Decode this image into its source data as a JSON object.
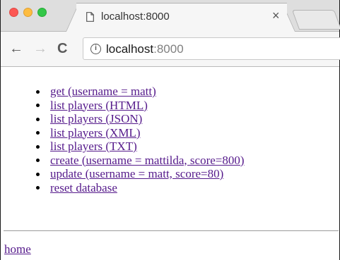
{
  "browser": {
    "tab": {
      "title": "localhost:8000",
      "close_glyph": "×",
      "icon": "page-icon"
    },
    "toolbar": {
      "back_glyph": "←",
      "forward_glyph": "→",
      "reload_glyph": "C",
      "info_glyph": "i",
      "url_host": "localhost",
      "url_port": ":8000"
    },
    "traffic_colors": {
      "close": "#fc5753",
      "minimize": "#fdbc40",
      "zoom": "#33c748"
    }
  },
  "page": {
    "links": [
      {
        "label": "get (username = matt)"
      },
      {
        "label": "list players (HTML)"
      },
      {
        "label": "list players (JSON)"
      },
      {
        "label": "list players (XML)"
      },
      {
        "label": "list players (TXT)"
      },
      {
        "label": "create (username = mattilda, score=800)"
      },
      {
        "label": "update (username = matt, score=80)"
      },
      {
        "label": "reset database"
      }
    ],
    "footer_link": "home",
    "link_color": "#551a8b"
  }
}
